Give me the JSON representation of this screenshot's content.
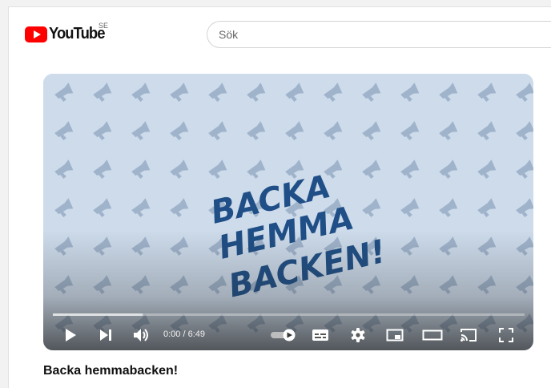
{
  "header": {
    "logo_text": "YouTube",
    "country_code": "SE",
    "search_placeholder": "Sök"
  },
  "player": {
    "artwork_text_lines": [
      "BACKA",
      "HEMMA",
      "BACKEN!"
    ],
    "time_display": "0:00 / 6:49",
    "progress_fraction": 0.19,
    "artwork_colors": {
      "background": "#cddbeb",
      "megaphone": "#9fb3cb",
      "lettering": "#1f4f86"
    },
    "controls": [
      "play-icon",
      "next-icon",
      "volume-icon",
      "autoplay-toggle-icon",
      "subtitles-icon",
      "settings-icon",
      "miniplayer-icon",
      "theater-mode-icon",
      "cast-icon",
      "fullscreen-icon"
    ]
  },
  "video": {
    "title": "Backa hemmabacken!"
  },
  "brand_color": "#ff0000"
}
